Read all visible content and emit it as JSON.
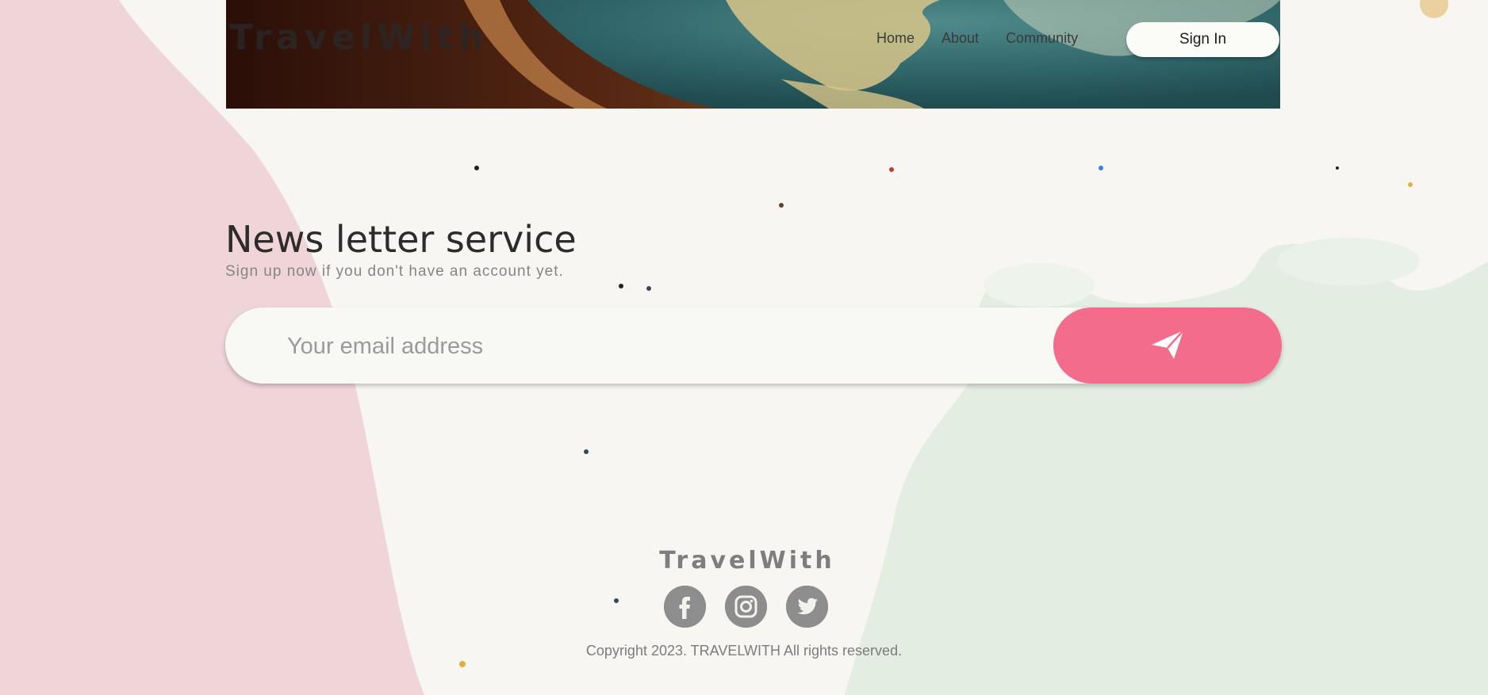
{
  "brand": {
    "logo": "TravelWith"
  },
  "header": {
    "nav": [
      {
        "label": "Home"
      },
      {
        "label": "About"
      },
      {
        "label": "Community"
      }
    ],
    "signin_label": "Sign In"
  },
  "newsletter": {
    "title": "News letter service",
    "subtitle": "Sign up now if you don't have an account yet.",
    "email_placeholder": "Your email address",
    "send_icon": "paper-plane-icon"
  },
  "footer": {
    "logo": "TravelWith",
    "social": [
      {
        "icon": "facebook-icon"
      },
      {
        "icon": "instagram-icon"
      },
      {
        "icon": "twitter-icon"
      }
    ],
    "copyright": "Copyright 2023. TRAVELWITH All rights reserved."
  },
  "colors": {
    "accent": "#f46c8b",
    "page_bg": "#f7f6f2",
    "pink_paint": "#efd4d8",
    "mint_paint": "#e4ede2",
    "icon_gray": "#8d8d8d"
  }
}
